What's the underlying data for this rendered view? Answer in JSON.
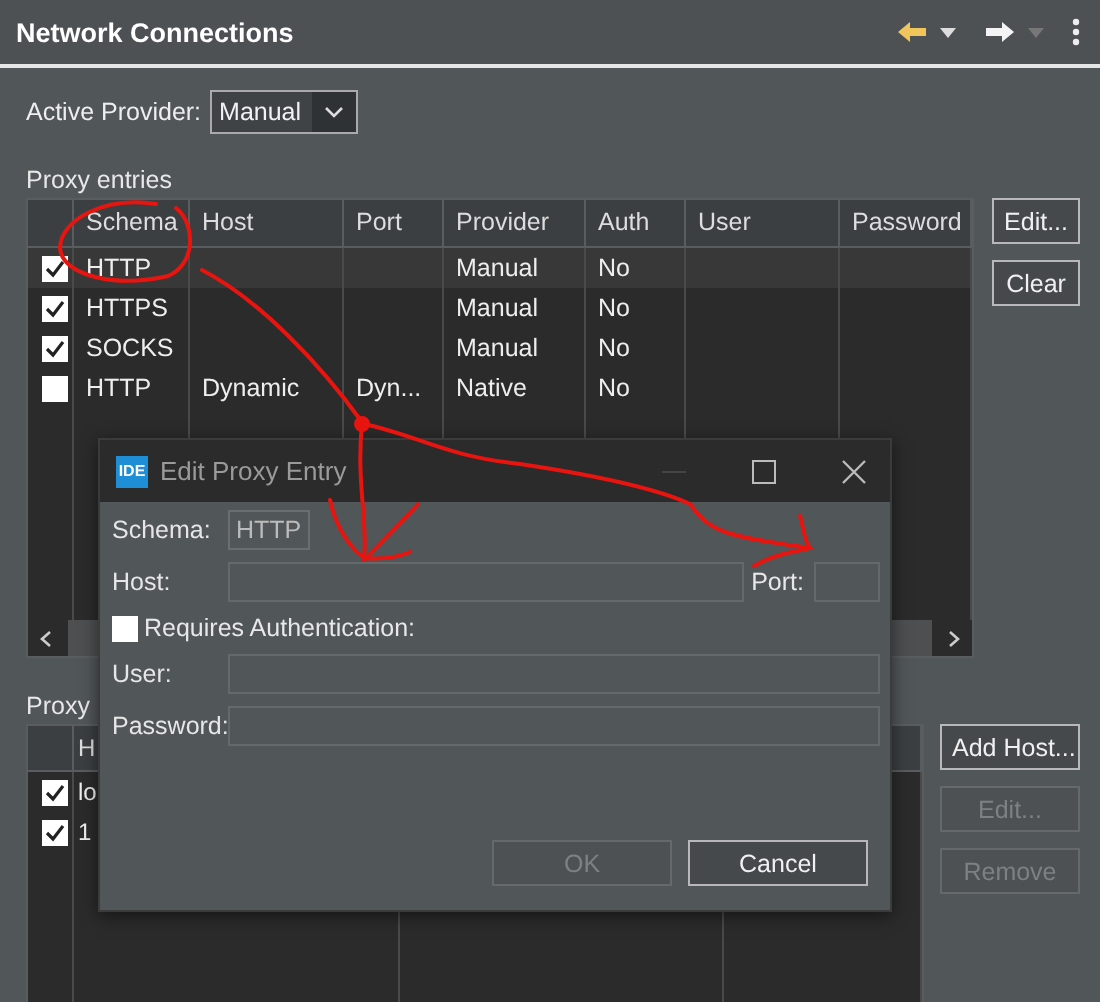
{
  "panel": {
    "title": "Network Connections"
  },
  "active_provider": {
    "label": "Active Provider:",
    "value": "Manual"
  },
  "proxy_entries": {
    "label": "Proxy entries",
    "columns": [
      "Schema",
      "Host",
      "Port",
      "Provider",
      "Auth",
      "User",
      "Password"
    ],
    "rows": [
      {
        "checked": true,
        "selected": true,
        "schema": "HTTP",
        "provider": "Manual",
        "auth": "No"
      },
      {
        "checked": true,
        "selected": false,
        "schema": "HTTPS",
        "provider": "Manual",
        "auth": "No"
      },
      {
        "checked": true,
        "selected": false,
        "schema": "SOCKS",
        "provider": "Manual",
        "auth": "No"
      },
      {
        "checked": false,
        "selected": false,
        "schema": "HTTP",
        "host": "Dynamic",
        "port": "Dyn...",
        "provider": "Native",
        "auth": "No"
      }
    ],
    "buttons": [
      {
        "label": "Edit...",
        "disabled": false
      },
      {
        "label": "Clear",
        "disabled": false
      }
    ]
  },
  "proxy_bypass": {
    "label": "Proxy",
    "columns": [
      "H"
    ],
    "rows": [
      {
        "checked": true,
        "text": "lo"
      },
      {
        "checked": true,
        "text": "1"
      }
    ],
    "buttons": [
      {
        "label": "Add Host...",
        "disabled": false
      },
      {
        "label": "Edit...",
        "disabled": true
      },
      {
        "label": "Remove",
        "disabled": true
      }
    ]
  },
  "dialog": {
    "title": "Edit Proxy Entry",
    "icon_text": "IDE",
    "schema_label": "Schema:",
    "schema_value": "HTTP",
    "host_label": "Host:",
    "port_label": "Port:",
    "auth": {
      "label": "Requires Authentication:",
      "checked": false
    },
    "user_label": "User:",
    "password_label": "Password:",
    "buttons": [
      {
        "label": "OK",
        "disabled": true
      },
      {
        "label": "Cancel",
        "disabled": false
      }
    ]
  }
}
